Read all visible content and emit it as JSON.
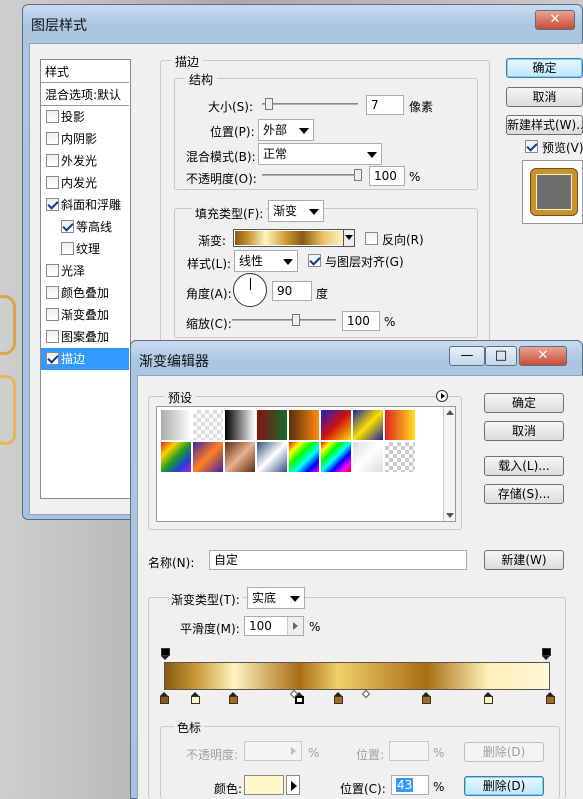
{
  "layer_style": {
    "title": "图层样式",
    "styles_header": "样式",
    "blend_default": "混合选项:默认",
    "items": [
      {
        "label": "投影",
        "checked": false
      },
      {
        "label": "内阴影",
        "checked": false
      },
      {
        "label": "外发光",
        "checked": false
      },
      {
        "label": "内发光",
        "checked": false
      },
      {
        "label": "斜面和浮雕",
        "checked": true
      },
      {
        "label": "等高线",
        "checked": true
      },
      {
        "label": "纹理",
        "checked": false
      },
      {
        "label": "光泽",
        "checked": false
      },
      {
        "label": "颜色叠加",
        "checked": false
      },
      {
        "label": "渐变叠加",
        "checked": false
      },
      {
        "label": "图案叠加",
        "checked": false
      },
      {
        "label": "描边",
        "checked": true
      }
    ],
    "stroke_title": "描边",
    "structure_title": "结构",
    "size_label": "大小(S):",
    "size_value": "7",
    "size_unit": "像素",
    "position_label": "位置(P):",
    "position_value": "外部",
    "blend_label": "混合模式(B):",
    "blend_value": "正常",
    "opacity_label": "不透明度(O):",
    "opacity_value": "100",
    "opacity_unit": "%",
    "fill_type_label": "填充类型(F):",
    "fill_type_value": "渐变",
    "gradient_label": "渐变:",
    "reverse_label": "反向(R)",
    "style_label": "样式(L):",
    "style_value": "线性",
    "align_label": "与图层对齐(G)",
    "angle_label": "角度(A):",
    "angle_value": "90",
    "angle_unit": "度",
    "scale_label": "缩放(C):",
    "scale_value": "100",
    "scale_unit": "%",
    "ok": "确定",
    "cancel": "取消",
    "new_style": "新建样式(W)...",
    "preview": "预览(V)"
  },
  "gradient_editor": {
    "title": "渐变编辑器",
    "presets_label": "预设",
    "ok": "确定",
    "cancel": "取消",
    "load": "载入(L)...",
    "save": "存储(S)...",
    "name_label": "名称(N):",
    "name_value": "自定",
    "new_button": "新建(W)",
    "type_label": "渐变类型(T):",
    "type_value": "实底",
    "smoothness_label": "平滑度(M):",
    "smoothness_value": "100",
    "smoothness_unit": "%",
    "stops_title": "色标",
    "opacity_label": "不透明度:",
    "opacity_unit": "%",
    "location_label": "位置:",
    "location_unit": "%",
    "delete_label": "删除(D)",
    "color_label": "颜色:",
    "color_location_label": "位置(C):",
    "color_location_value": "43",
    "color_location_unit": "%",
    "color_delete_label": "删除(D)",
    "selected_color": "#fff9c8",
    "color_stops_percent": [
      0,
      8,
      18,
      35,
      45,
      68,
      84,
      100
    ]
  },
  "colors": {
    "selection": "#3399ff",
    "gold_dark": "#8a5a12",
    "gold_light": "#fff4c0"
  }
}
